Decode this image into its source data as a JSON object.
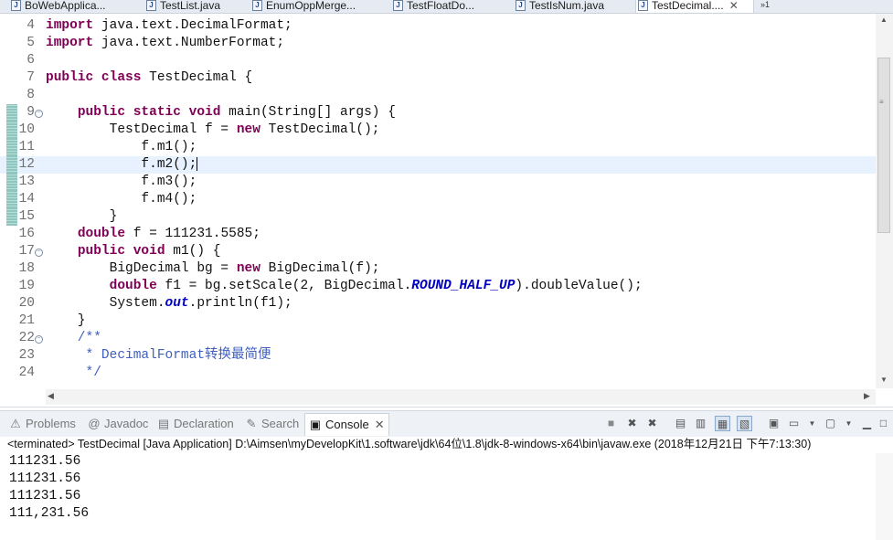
{
  "editor_tabs": [
    {
      "label": "BoWebApplica...",
      "active": false
    },
    {
      "label": "TestList.java",
      "active": false
    },
    {
      "label": "EnumOppMerge...",
      "active": false
    },
    {
      "label": "TestFloatDo...",
      "active": false
    },
    {
      "label": "TestIsNum.java",
      "active": false
    },
    {
      "label": "TestDecimal....",
      "active": true
    }
  ],
  "overflow_count": "»1",
  "editor": {
    "current_line": 12,
    "lines": [
      {
        "n": "4",
        "text": "import java.text.DecimalFormat;"
      },
      {
        "n": "5",
        "text": "import java.text.NumberFormat;"
      },
      {
        "n": "6",
        "text": ""
      },
      {
        "n": "7",
        "text": "public class TestDecimal {"
      },
      {
        "n": "8",
        "text": ""
      },
      {
        "n": "9",
        "text": "    public static void main(String[] args) {"
      },
      {
        "n": "10",
        "text": "        TestDecimal f = new TestDecimal();"
      },
      {
        "n": "11",
        "text": "            f.m1();"
      },
      {
        "n": "12",
        "text": "            f.m2();"
      },
      {
        "n": "13",
        "text": "            f.m3();"
      },
      {
        "n": "14",
        "text": "            f.m4();"
      },
      {
        "n": "15",
        "text": "        }"
      },
      {
        "n": "16",
        "text": "    double f = 111231.5585;"
      },
      {
        "n": "17",
        "text": "    public void m1() {"
      },
      {
        "n": "18",
        "text": "        BigDecimal bg = new BigDecimal(f);"
      },
      {
        "n": "19",
        "text": "        double f1 = bg.setScale(2, BigDecimal.ROUND_HALF_UP).doubleValue();"
      },
      {
        "n": "20",
        "text": "        System.out.println(f1);"
      },
      {
        "n": "21",
        "text": "    }"
      },
      {
        "n": "22",
        "text": "    /**"
      },
      {
        "n": "23",
        "text": "     * DecimalFormat转换最简便"
      },
      {
        "n": "24",
        "text": "     */"
      }
    ]
  },
  "views": {
    "tabs": [
      {
        "label": "Problems",
        "icon": "problems-icon",
        "active": false
      },
      {
        "label": "Javadoc",
        "icon": "javadoc-icon",
        "active": false
      },
      {
        "label": "Declaration",
        "icon": "declaration-icon",
        "active": false
      },
      {
        "label": "Search",
        "icon": "search-icon",
        "active": false
      },
      {
        "label": "Console",
        "icon": "console-icon",
        "active": true
      }
    ]
  },
  "console": {
    "header": "<terminated> TestDecimal [Java Application] D:\\Aimsen\\myDevelopKit\\1.software\\jdk\\64位\\1.8\\jdk-8-windows-x64\\bin\\javaw.exe (2018年12月21日 下午7:13:30)",
    "output": [
      "111231.56",
      "111231.56",
      "111231.56",
      "111,231.56"
    ]
  },
  "colors": {
    "keyword": "#7f0055",
    "field": "#0000c0",
    "comment": "#3f5fbf",
    "current_line": "#e8f2fe",
    "change_marker": "#8fc5bf"
  }
}
